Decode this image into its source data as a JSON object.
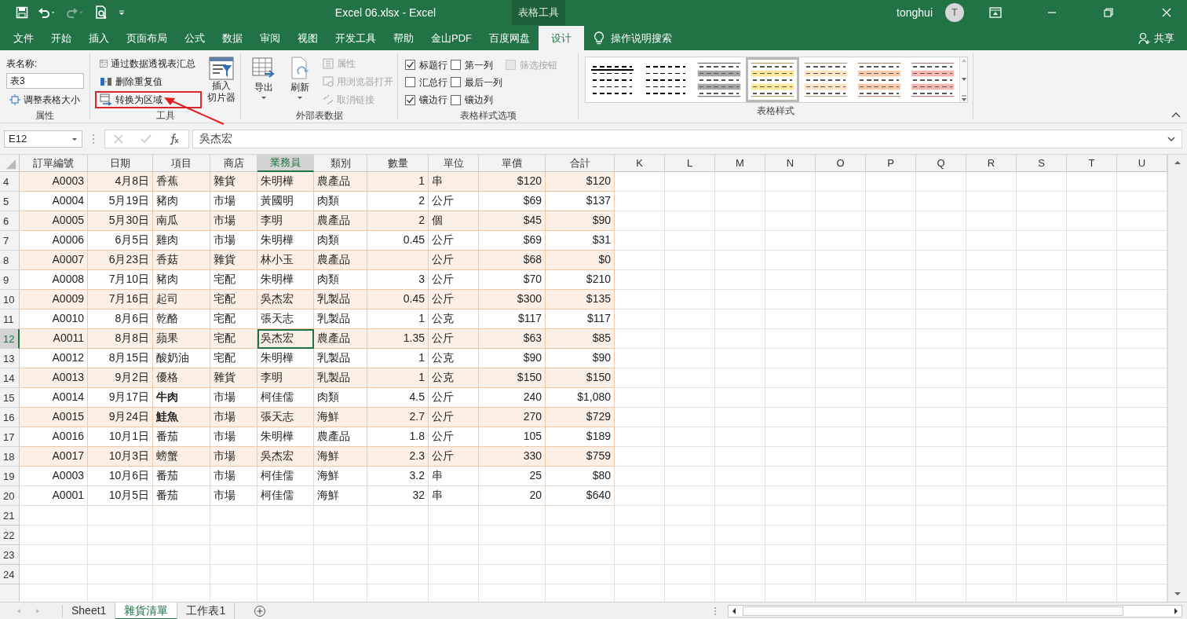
{
  "title_bar": {
    "title": "Excel 06.xlsx  -  Excel",
    "context_tab": "表格工具",
    "user": "tonghui",
    "avatar": "T"
  },
  "menu_tabs": [
    {
      "label": "文件",
      "selected": false
    },
    {
      "label": "开始",
      "selected": false
    },
    {
      "label": "插入",
      "selected": false
    },
    {
      "label": "页面布局",
      "selected": false
    },
    {
      "label": "公式",
      "selected": false
    },
    {
      "label": "数据",
      "selected": false
    },
    {
      "label": "审阅",
      "selected": false
    },
    {
      "label": "视图",
      "selected": false
    },
    {
      "label": "开发工具",
      "selected": false
    },
    {
      "label": "帮助",
      "selected": false
    },
    {
      "label": "金山PDF",
      "selected": false
    },
    {
      "label": "百度网盘",
      "selected": false
    },
    {
      "label": "设计",
      "selected": true
    }
  ],
  "tell_me": "操作说明搜索",
  "share": "共享",
  "ribbon": {
    "properties": {
      "name_label": "表名称:",
      "table_name": "表3",
      "resize": "调整表格大小",
      "group": "属性"
    },
    "tools": {
      "buttons": [
        {
          "label": "通过数据透视表汇总",
          "highlighted": false
        },
        {
          "label": "删除重复值",
          "highlighted": false
        },
        {
          "label": "转换为区域",
          "highlighted": true
        }
      ],
      "slicer": [
        "插入",
        "切片器"
      ],
      "group": "工具"
    },
    "external": {
      "big": [
        {
          "label": "导出"
        },
        {
          "label": "刷新"
        }
      ],
      "small": [
        {
          "label": "属性",
          "disabled": true
        },
        {
          "label": "用浏览器打开",
          "disabled": true
        },
        {
          "label": "取消链接",
          "disabled": true
        }
      ],
      "group": "外部表数据"
    },
    "style_options": {
      "items": [
        {
          "label": "标题行",
          "checked": true,
          "disabled": false
        },
        {
          "label": "汇总行",
          "checked": false,
          "disabled": false
        },
        {
          "label": "镶边行",
          "checked": true,
          "disabled": false
        },
        {
          "label": "第一列",
          "checked": false,
          "disabled": false
        },
        {
          "label": "最后一列",
          "checked": false,
          "disabled": false
        },
        {
          "label": "镶边列",
          "checked": false,
          "disabled": false
        },
        {
          "label": "筛选按钮",
          "checked": false,
          "disabled": true
        }
      ],
      "group": "表格样式选项"
    },
    "styles": {
      "swatches": [
        {
          "kind": "rule",
          "color": "#000000",
          "selected": false
        },
        {
          "kind": "plain",
          "color": "#000000",
          "selected": false
        },
        {
          "kind": "banded",
          "color": "#a6a6a6",
          "selected": false
        },
        {
          "kind": "banded",
          "color": "#ffe699",
          "selected": true
        },
        {
          "kind": "banded",
          "color": "#fce4c4",
          "selected": false
        },
        {
          "kind": "banded",
          "color": "#f8cbad",
          "selected": false
        },
        {
          "kind": "banded",
          "color": "#f4b6b0",
          "selected": false
        }
      ],
      "group": "表格样式"
    }
  },
  "formula_bar": {
    "name_box": "E12",
    "value": "吳杰宏"
  },
  "sheet": {
    "columns": [
      {
        "label": "訂單編號",
        "selected": false
      },
      {
        "label": "日期",
        "selected": false
      },
      {
        "label": "項目",
        "selected": false
      },
      {
        "label": "商店",
        "selected": false
      },
      {
        "label": "業務員",
        "selected": true
      },
      {
        "label": "類別",
        "selected": false
      },
      {
        "label": "數量",
        "selected": false
      },
      {
        "label": "單位",
        "selected": false
      },
      {
        "label": "單價",
        "selected": false
      },
      {
        "label": "合計",
        "selected": false
      },
      {
        "label": "K",
        "selected": false
      },
      {
        "label": "L",
        "selected": false
      },
      {
        "label": "M",
        "selected": false
      },
      {
        "label": "N",
        "selected": false
      },
      {
        "label": "O",
        "selected": false
      },
      {
        "label": "P",
        "selected": false
      },
      {
        "label": "Q",
        "selected": false
      },
      {
        "label": "R",
        "selected": false
      },
      {
        "label": "S",
        "selected": false
      },
      {
        "label": "T",
        "selected": false
      },
      {
        "label": "U",
        "selected": false
      }
    ],
    "rows": [
      {
        "row": "4",
        "selected": false,
        "in_table": true,
        "item_bold": false,
        "cells": [
          "A0003",
          "4月8日",
          "香蕉",
          "雜貨",
          "朱明樺",
          "農產品",
          "1",
          "串",
          "$120",
          "$120"
        ]
      },
      {
        "row": "5",
        "selected": false,
        "in_table": true,
        "item_bold": false,
        "cells": [
          "A0004",
          "5月19日",
          "豬肉",
          "市場",
          "黃國明",
          "肉類",
          "2",
          "公斤",
          "$69",
          "$137"
        ]
      },
      {
        "row": "6",
        "selected": false,
        "in_table": true,
        "item_bold": false,
        "cells": [
          "A0005",
          "5月30日",
          "南瓜",
          "市場",
          "李明",
          "農產品",
          "2",
          "個",
          "$45",
          "$90"
        ]
      },
      {
        "row": "7",
        "selected": false,
        "in_table": true,
        "item_bold": false,
        "cells": [
          "A0006",
          "6月5日",
          "雞肉",
          "市場",
          "朱明樺",
          "肉類",
          "0.45",
          "公斤",
          "$69",
          "$31"
        ]
      },
      {
        "row": "8",
        "selected": false,
        "in_table": true,
        "item_bold": false,
        "cells": [
          "A0007",
          "6月23日",
          "香菇",
          "雜貨",
          "林小玉",
          "農產品",
          null,
          "公斤",
          "$68",
          "$0"
        ]
      },
      {
        "row": "9",
        "selected": false,
        "in_table": true,
        "item_bold": false,
        "cells": [
          "A0008",
          "7月10日",
          "豬肉",
          "宅配",
          "朱明樺",
          "肉類",
          "3",
          "公斤",
          "$70",
          "$210"
        ]
      },
      {
        "row": "10",
        "selected": false,
        "in_table": true,
        "item_bold": false,
        "cells": [
          "A0009",
          "7月16日",
          "起司",
          "宅配",
          "吳杰宏",
          "乳製品",
          "0.45",
          "公斤",
          "$300",
          "$135"
        ]
      },
      {
        "row": "11",
        "selected": false,
        "in_table": true,
        "item_bold": false,
        "cells": [
          "A0010",
          "8月6日",
          "乾酪",
          "宅配",
          "張天志",
          "乳製品",
          "1",
          "公克",
          "$117",
          "$117"
        ]
      },
      {
        "row": "12",
        "selected": true,
        "in_table": true,
        "item_bold": false,
        "cells": [
          "A0011",
          "8月8日",
          "蘋果",
          "宅配",
          "吳杰宏",
          "農產品",
          "1.35",
          "公斤",
          "$63",
          "$85"
        ]
      },
      {
        "row": "13",
        "selected": false,
        "in_table": true,
        "item_bold": false,
        "cells": [
          "A0012",
          "8月15日",
          "酸奶油",
          "宅配",
          "朱明樺",
          "乳製品",
          "1",
          "公克",
          "$90",
          "$90"
        ]
      },
      {
        "row": "14",
        "selected": false,
        "in_table": true,
        "item_bold": false,
        "cells": [
          "A0013",
          "9月2日",
          "優格",
          "雜貨",
          "李明",
          "乳製品",
          "1",
          "公克",
          "$150",
          "$150"
        ]
      },
      {
        "row": "15",
        "selected": false,
        "in_table": true,
        "item_bold": true,
        "cells": [
          "A0014",
          "9月17日",
          "牛肉",
          "市場",
          "柯佳儒",
          "肉類",
          "4.5",
          "公斤",
          "240",
          "$1,080"
        ]
      },
      {
        "row": "16",
        "selected": false,
        "in_table": true,
        "item_bold": true,
        "cells": [
          "A0015",
          "9月24日",
          "鮭魚",
          "市場",
          "張天志",
          "海鮮",
          "2.7",
          "公斤",
          "270",
          "$729"
        ]
      },
      {
        "row": "17",
        "selected": false,
        "in_table": true,
        "item_bold": false,
        "cells": [
          "A0016",
          "10月1日",
          "番茄",
          "市場",
          "朱明樺",
          "農產品",
          "1.8",
          "公斤",
          "105",
          "$189"
        ]
      },
      {
        "row": "18",
        "selected": false,
        "in_table": true,
        "item_bold": false,
        "cells": [
          "A0017",
          "10月3日",
          "螃蟹",
          "市場",
          "吳杰宏",
          "海鮮",
          "2.3",
          "公斤",
          "330",
          "$759"
        ]
      },
      {
        "row": "19",
        "selected": false,
        "in_table": false,
        "item_bold": false,
        "cells": [
          "A0003",
          "10月6日",
          "番茄",
          "市場",
          "柯佳儒",
          "海鮮",
          "3.2",
          "串",
          "25",
          "$80"
        ]
      },
      {
        "row": "20",
        "selected": false,
        "in_table": false,
        "item_bold": false,
        "cells": [
          "A0001",
          "10月5日",
          "番茄",
          "市場",
          "柯佳儒",
          "海鮮",
          "32",
          "串",
          "20",
          "$640"
        ]
      }
    ],
    "empty_rows": [
      "21",
      "22",
      "23",
      "24"
    ]
  },
  "sheet_tabs": [
    {
      "label": "Sheet1",
      "selected": false
    },
    {
      "label": "雜貨清單",
      "selected": true
    },
    {
      "label": "工作表1",
      "selected": false
    }
  ]
}
